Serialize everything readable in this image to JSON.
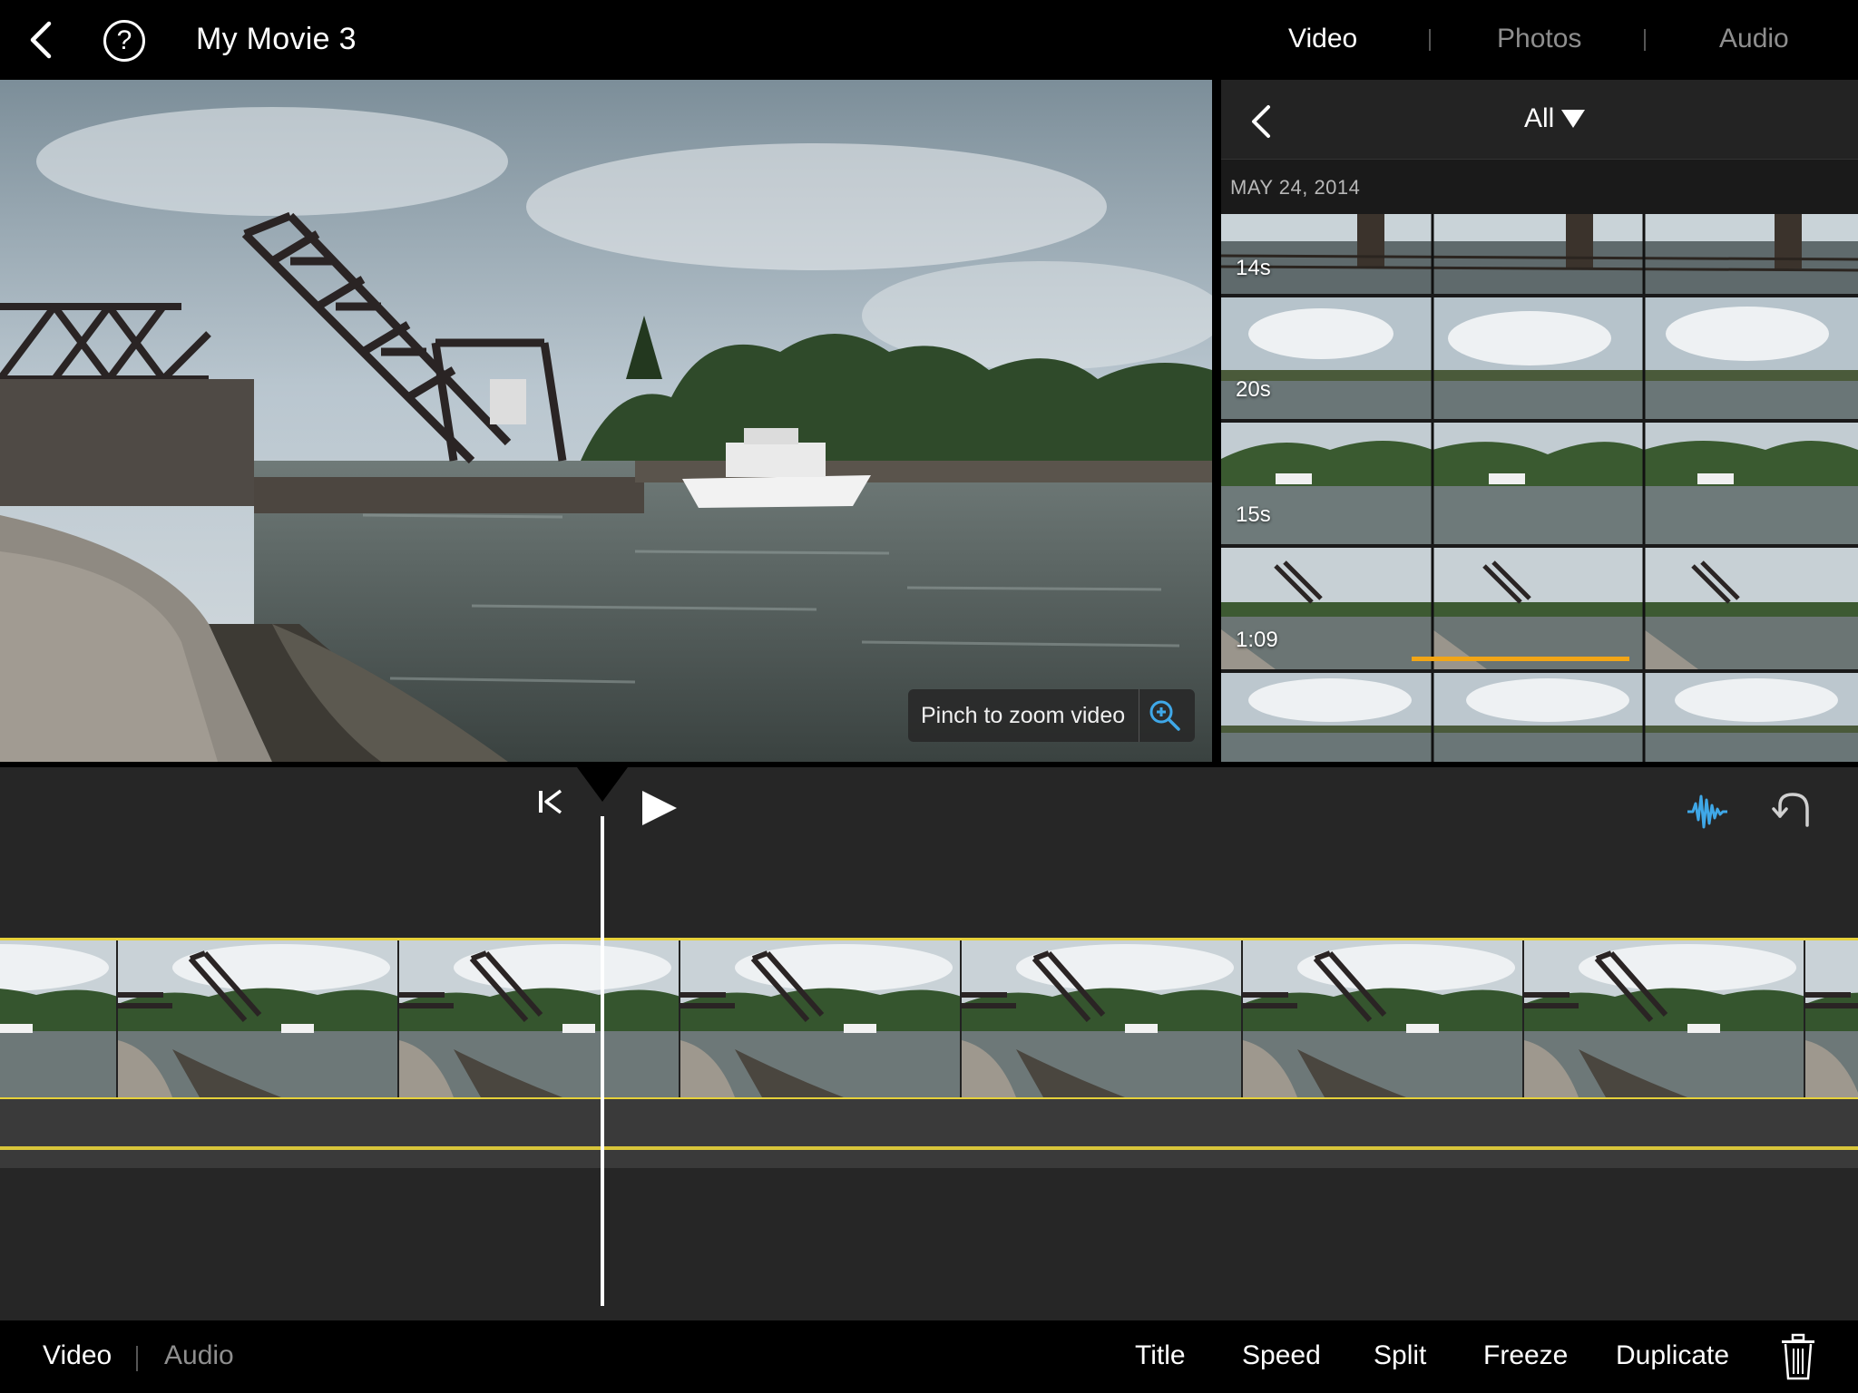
{
  "header": {
    "project_title": "My Movie 3",
    "help_glyph": "?",
    "tabs": [
      {
        "label": "Video",
        "active": true
      },
      {
        "label": "Photos",
        "active": false
      },
      {
        "label": "Audio",
        "active": false
      }
    ]
  },
  "preview": {
    "zoom_hint": "Pinch to zoom video"
  },
  "browser": {
    "filter_label": "All",
    "date_label": "MAY 24, 2014",
    "clips": [
      {
        "duration": "14s"
      },
      {
        "duration": "20s"
      },
      {
        "duration": "15s"
      },
      {
        "duration": "1:09",
        "selected": true
      },
      {
        "duration": ""
      }
    ]
  },
  "bottom_bar": {
    "modes": [
      {
        "label": "Video",
        "active": true
      },
      {
        "label": "Audio",
        "active": false
      }
    ],
    "actions": [
      "Title",
      "Speed",
      "Split",
      "Freeze",
      "Duplicate"
    ]
  },
  "colors": {
    "accent_blue": "#3fa8e8",
    "track_yellow": "#e6d13a",
    "selection_orange": "#f2a516"
  },
  "icons": [
    "back-chevron-icon",
    "help-icon",
    "chevron-down-icon",
    "zoom-in-icon",
    "skip-to-start-icon",
    "play-icon",
    "waveform-icon",
    "undo-icon",
    "trash-icon"
  ]
}
